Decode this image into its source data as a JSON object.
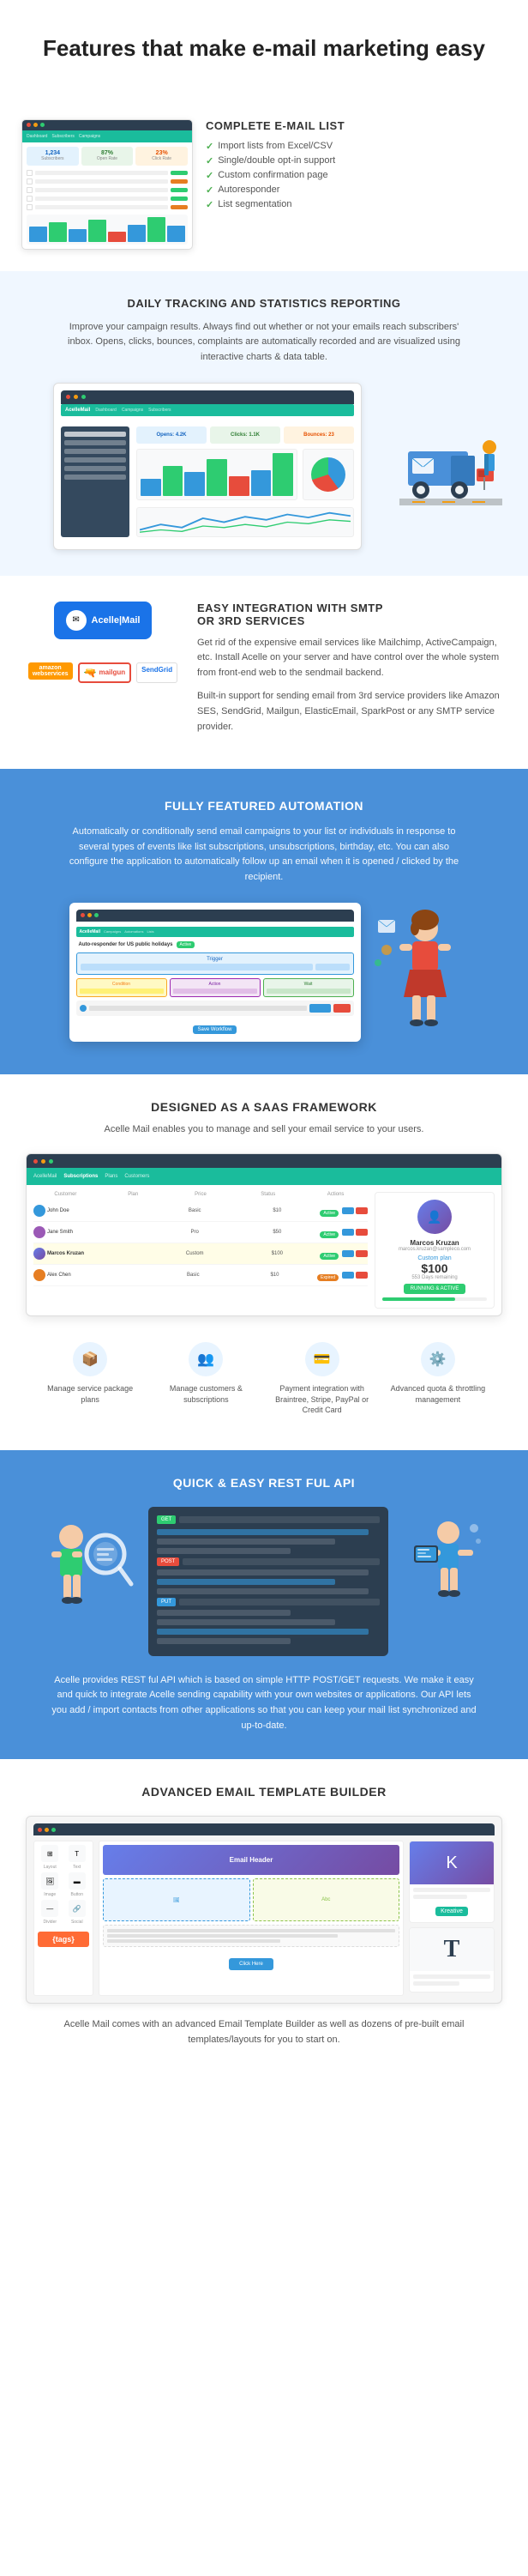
{
  "page": {
    "hero": {
      "title": "Features that make\ne-mail marketing easy"
    },
    "sections": {
      "complete_email_list": {
        "title": "COMPLETE E-MAIL LIST",
        "features": [
          "Import lists from Excel/CSV",
          "Single/double opt-in support",
          "Custom confirmation page",
          "Autoresponder",
          "List segmentation"
        ]
      },
      "tracking": {
        "title": "DAILY TRACKING AND STATISTICS REPORTING",
        "description": "Improve your campaign results. Always find out whether or not your emails reach subscribers' inbox. Opens, clicks, bounces, complaints are automatically recorded and are visualized using interactive charts & data table."
      },
      "smtp": {
        "title": "EASY INTEGRATION WITH SMTP\nOR 3RD SERVICES",
        "logo_text": "Acelle|Mail",
        "description1": "Get rid of the expensive email services like Mailchimp, ActiveCampaign, etc. Install Acelle on your server and have control over the whole system from front-end web to the sendmail backend.",
        "description2": "Built-in support for sending email from 3rd service providers like Amazon SES, SendGrid, Mailgun, ElasticEmail, SparkPost or any SMTP service provider.",
        "providers": [
          "amazon\nwebservices",
          "mailgun",
          "SendGrid"
        ]
      },
      "automation": {
        "title": "FULLY FEATURED AUTOMATION",
        "description": "Automatically or conditionally send email campaigns to your list or individuals in response to several types of events like list subscriptions, unsubscriptions, birthday, etc. You can also configure the application to automatically follow up an email when it is opened / clicked by the recipient.",
        "workflow_label": "Auto-responder for US public holidays"
      },
      "saas": {
        "title": "DESIGNED AS A SAAS FRAMEWORK",
        "description": "Acelle Mail enables you to manage and sell your email service to your users.",
        "card": {
          "name": "Marcos Kruzan",
          "email": "marcos.kruzan@sampleco.com",
          "plan": "Custom plan",
          "price": "$100",
          "days": "553 Days remaining",
          "status": "RUNNING & ACTIVE"
        },
        "features": [
          {
            "icon": "📦",
            "label": "Manage service package plans"
          },
          {
            "icon": "👥",
            "label": "Manage customers & subscriptions"
          },
          {
            "icon": "💳",
            "label": "Payment integration with Braintree, Stripe, PayPal or Credit Card"
          },
          {
            "icon": "⚙️",
            "label": "Advanced quota & throttling management"
          }
        ]
      },
      "api": {
        "title": "QUICK & EASY REST FUL API",
        "description": "Acelle provides REST ful API which is based on simple HTTP POST/GET requests. We make it easy and quick to integrate Acelle sending capability with your own websites or applications. Our API lets you add / import contacts from other applications so that you can keep your mail list synchronized and up-to-date."
      },
      "template_builder": {
        "title": "ADVANCED EMAIL TEMPLATE BUILDER",
        "description": "Acelle Mail comes with an advanced Email Template Builder as well as dozens of pre-built email templates/layouts for you to start on.",
        "badge": "Kreative",
        "tags_label": "{tags}"
      }
    }
  }
}
